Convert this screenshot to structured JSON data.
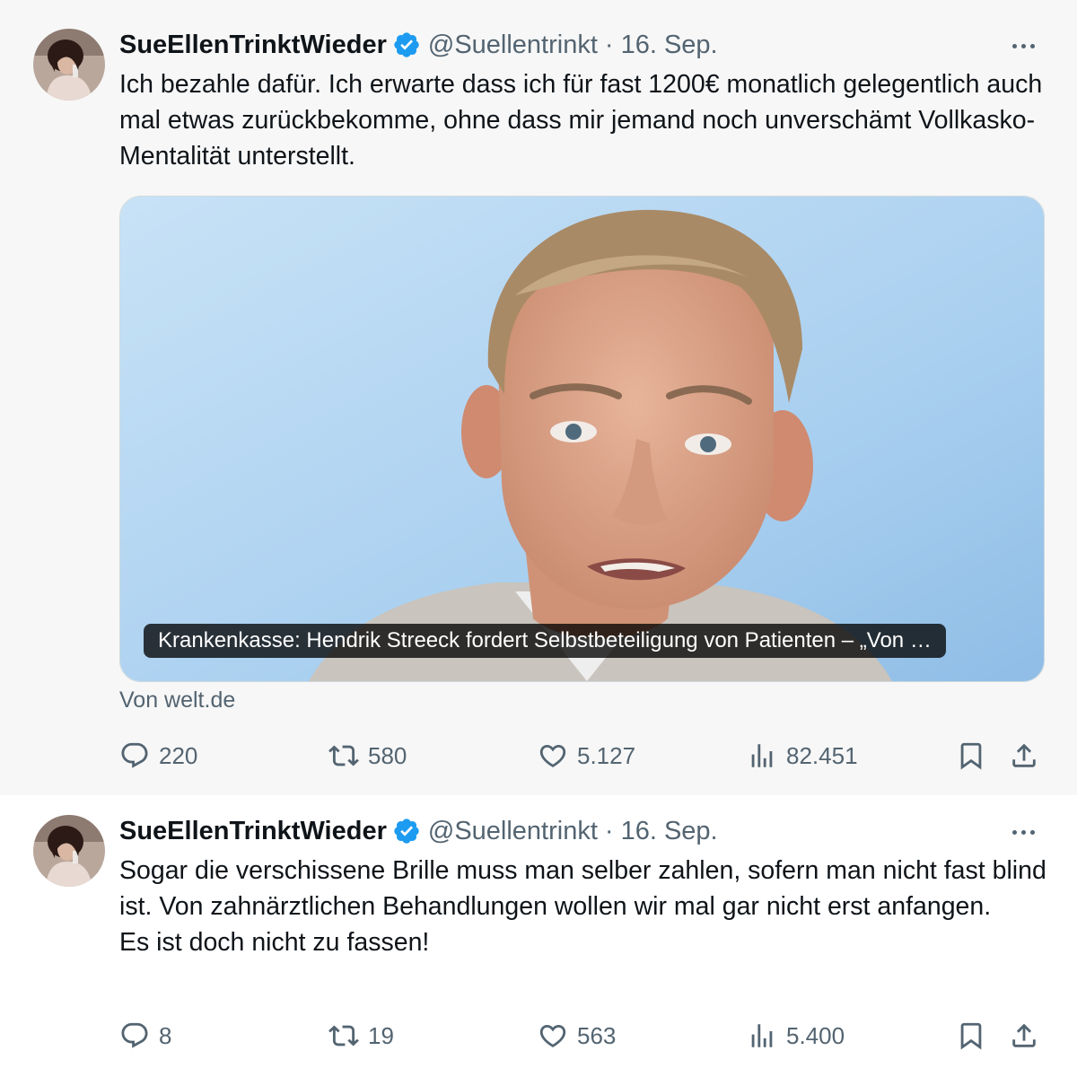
{
  "tweets": [
    {
      "author": {
        "name": "SueEllenTrinktWieder",
        "handle": "@Suellentrinkt",
        "verified": true,
        "verified_color": "#1d9bf0"
      },
      "separator": "·",
      "date": "16. Sep.",
      "text": [
        "Ich bezahle dafür. Ich erwarte dass ich für fast 1200€ monatlich gelegentlich auch mal etwas zurückbekomme, ohne dass mir jemand noch unverschämt Vollkasko-Mentalität unterstellt."
      ],
      "link_card": {
        "caption": "Krankenkasse: Hendrik Streeck fordert Selbstbeteiligung von Patienten – „Von …",
        "source": "Von welt.de"
      },
      "stats": {
        "replies": "220",
        "reposts": "580",
        "likes": "5.127",
        "views": "82.451"
      }
    },
    {
      "author": {
        "name": "SueEllenTrinktWieder",
        "handle": "@Suellentrinkt",
        "verified": true,
        "verified_color": "#1d9bf0"
      },
      "separator": "·",
      "date": "16. Sep.",
      "text": [
        "Sogar die verschissene Brille muss man selber zahlen, sofern man nicht fast blind ist. Von zahnärztlichen Behandlungen wollen wir mal gar nicht erst anfangen.",
        "Es ist doch nicht zu fassen!"
      ],
      "stats": {
        "replies": "8",
        "reposts": "19",
        "likes": "563",
        "views": "5.400"
      }
    }
  ],
  "colors": {
    "text": "#0f1419",
    "secondary": "#536471",
    "accent": "#1d9bf0",
    "thread_line": "#cfd9de"
  },
  "icons": [
    "more-icon",
    "verified-badge-icon",
    "reply-icon",
    "repost-icon",
    "like-icon",
    "views-icon",
    "bookmark-icon",
    "share-icon"
  ]
}
